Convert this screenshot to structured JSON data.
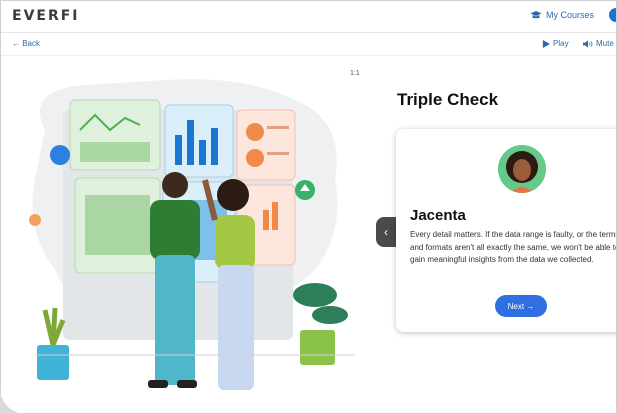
{
  "header": {
    "logo": "EVERFI",
    "my_courses": "My Courses"
  },
  "nav": {
    "back": "← Back",
    "play": "Play",
    "mute": "Mute"
  },
  "page_indicator": "1:1",
  "main": {
    "title": "Triple Check",
    "card": {
      "name": "Jacenta",
      "body": "Every detail matters. If the data range is faulty, or the terms and formats aren't all exactly the same, we won't be able to gain meaningful insights from the data we collected.",
      "next_label": "Next →"
    }
  },
  "icons": {
    "graduation": "graduation-cap-icon",
    "play": "play-icon",
    "mute": "speaker-icon",
    "prev": "chevron-left-icon"
  },
  "colors": {
    "accent": "#2f6fe0",
    "link": "#2c6ab4"
  }
}
